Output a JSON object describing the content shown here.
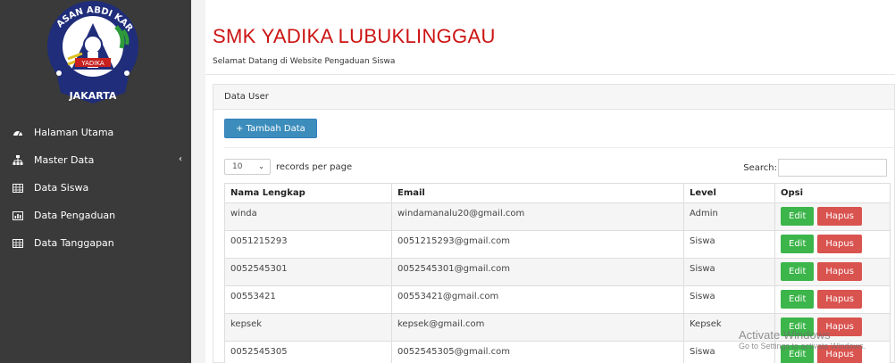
{
  "logo": {
    "arc_text": "YAYASAN ABDI KARYA",
    "band_text": "YADIKA",
    "bottom_text": "JAKARTA"
  },
  "sidebar": {
    "items": [
      {
        "label": "Halaman Utama",
        "icon": "dashboard-icon"
      },
      {
        "label": "Master Data",
        "icon": "sitemap-icon",
        "chevron": "‹"
      },
      {
        "label": "Data Siswa",
        "icon": "table-icon"
      },
      {
        "label": "Data Pengaduan",
        "icon": "chart-icon"
      },
      {
        "label": "Data Tanggapan",
        "icon": "table-icon"
      }
    ]
  },
  "header": {
    "title": "SMK YADIKA LUBUKLINGGAU",
    "subtitle": "Selamat Datang di Website Pengaduan Siswa"
  },
  "panel": {
    "heading": "Data User",
    "add_button": "+ Tambah Data",
    "length_value": "10",
    "length_label": "records per page",
    "search_label": "Search:",
    "columns": [
      "Nama Lengkap",
      "Email",
      "Level",
      "Opsi"
    ],
    "edit_label": "Edit",
    "delete_label": "Hapus",
    "rows": [
      {
        "nama": "winda",
        "email": "windamanalu20@gmail.com",
        "level": "Admin"
      },
      {
        "nama": "0051215293",
        "email": "0051215293@gmail.com",
        "level": "Siswa"
      },
      {
        "nama": "0052545301",
        "email": "0052545301@gmail.com",
        "level": "Siswa"
      },
      {
        "nama": "00553421",
        "email": "00553421@gmail.com",
        "level": "Siswa"
      },
      {
        "nama": "kepsek",
        "email": "kepsek@gmail.com",
        "level": "Kepsek"
      },
      {
        "nama": "0052545305",
        "email": "0052545305@gmail.com",
        "level": "Siswa"
      }
    ]
  },
  "watermark": {
    "line1": "Activate Windows",
    "line2": "Go to Settings to activate Windows."
  }
}
